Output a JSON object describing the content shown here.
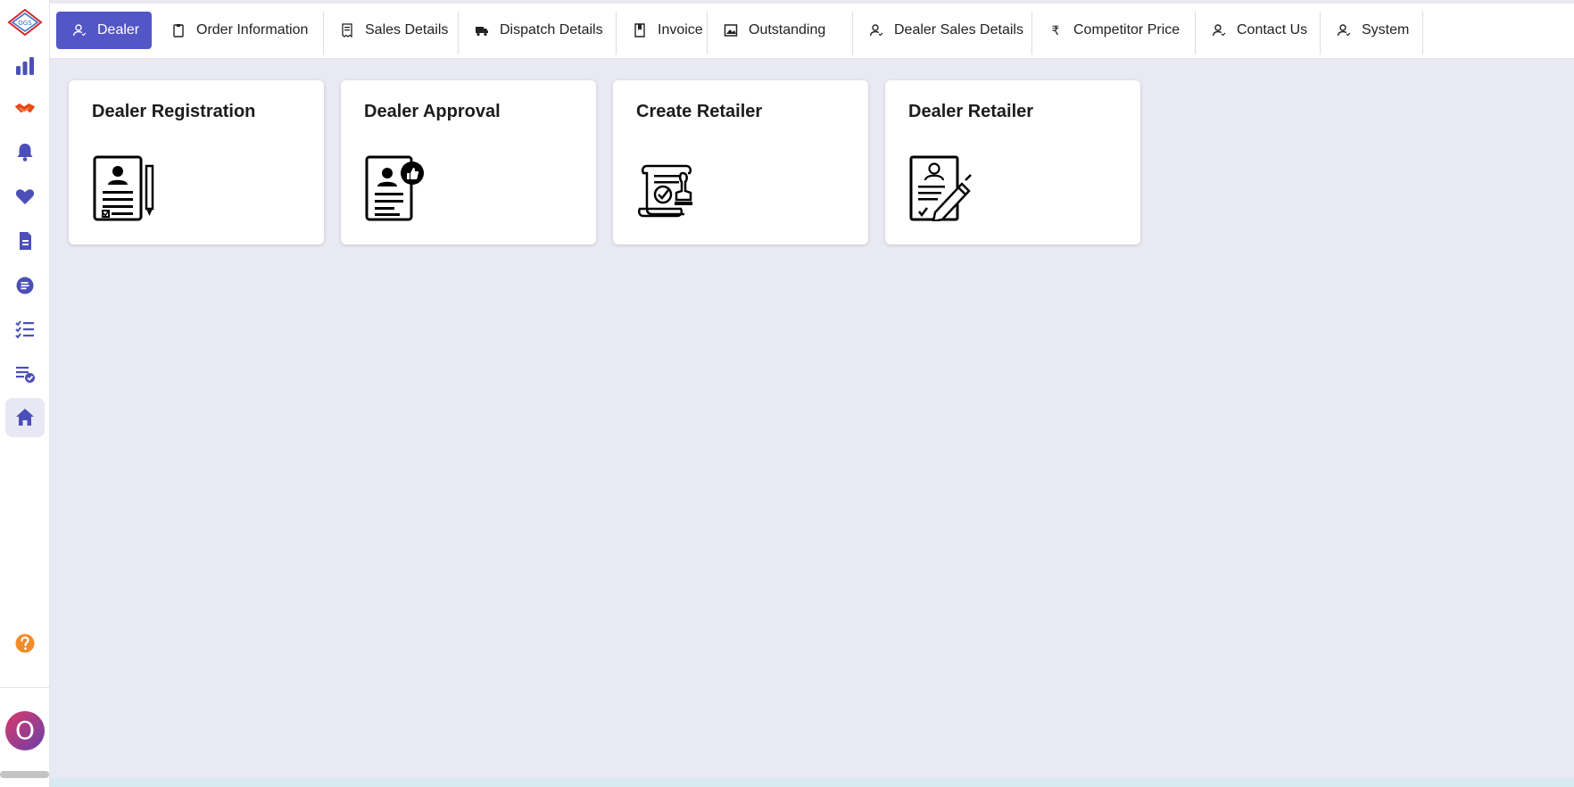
{
  "logo": {
    "text": "OGS"
  },
  "sidebar": {
    "items": [
      {
        "icon": "bar-chart-icon",
        "color": "#4c4fb8"
      },
      {
        "icon": "handshake-icon",
        "color": "#e64a19"
      },
      {
        "icon": "bell-icon",
        "color": "#4c4fb8"
      },
      {
        "icon": "heart-icon",
        "color": "#4c4fb8"
      },
      {
        "icon": "document-icon",
        "color": "#4c4fb8"
      },
      {
        "icon": "chat-icon",
        "color": "#4c4fb8"
      },
      {
        "icon": "checklist-icon",
        "color": "#4c4fb8"
      },
      {
        "icon": "task-check-icon",
        "color": "#4c4fb8"
      },
      {
        "icon": "home-icon",
        "color": "#4c4fb8",
        "active": true
      }
    ],
    "help_icon": "help-icon",
    "avatar_letter": "O"
  },
  "tabs": [
    {
      "label": "Dealer",
      "icon": "user-icon",
      "active": true
    },
    {
      "label": "Order Information",
      "icon": "clipboard-icon"
    },
    {
      "label": "Sales Details",
      "icon": "receipt-icon"
    },
    {
      "label": "Dispatch Details",
      "icon": "truck-icon"
    },
    {
      "label": "Invoice",
      "icon": "bookmark-icon"
    },
    {
      "label": "Outstanding",
      "icon": "image-icon"
    },
    {
      "label": "Dealer Sales Details",
      "icon": "user-icon"
    },
    {
      "label": "Competitor Price",
      "icon": "rupee-icon",
      "symbol": "₹"
    },
    {
      "label": "Contact Us",
      "icon": "user-icon"
    },
    {
      "label": "System",
      "icon": "user-icon"
    }
  ],
  "cards": [
    {
      "title": "Dealer Registration",
      "icon": "registration-form-icon"
    },
    {
      "title": "Dealer Approval",
      "icon": "approval-form-icon"
    },
    {
      "title": "Create Retailer",
      "icon": "certificate-stamp-icon"
    },
    {
      "title": "Dealer Retailer",
      "icon": "contract-sign-icon"
    }
  ],
  "colors": {
    "accent": "#5356c6",
    "background": "#e9e9f4",
    "help": "#f28c28"
  }
}
